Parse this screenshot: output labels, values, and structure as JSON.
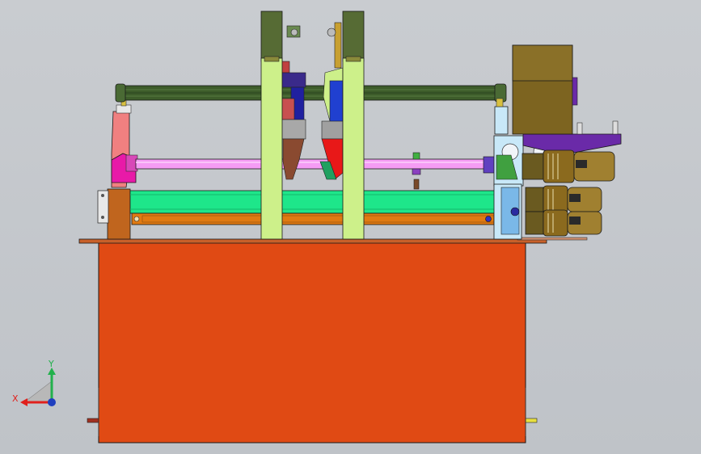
{
  "viewport": {
    "background": "#c6c9cd",
    "view_orientation": "front"
  },
  "triad": {
    "x_label": "X",
    "y_label": "Y",
    "x_color": "#e0201c",
    "y_color": "#22b14c",
    "z_color": "#1f3fbf"
  },
  "colors": {
    "base_cabinet": "#e04a14",
    "top_plate": "#c8602a",
    "upright_column": "#cdf08a",
    "column_cap": "#566b34",
    "guide_rod": "#f59cf5",
    "green_rail": "#1ee68a",
    "orange_beam": "#e07a12",
    "top_shaft": "#3d5c2a",
    "gear_motor": "#8b6a1e",
    "motor_box": "#7d6420",
    "side_bracket": "#f08080",
    "magenta_block": "#e81aa8",
    "right_frame": "#c8e8f8",
    "purple_plate": "#6a2aa8",
    "red_cutter": "#e81818",
    "brown_cutter": "#8a4a30"
  }
}
